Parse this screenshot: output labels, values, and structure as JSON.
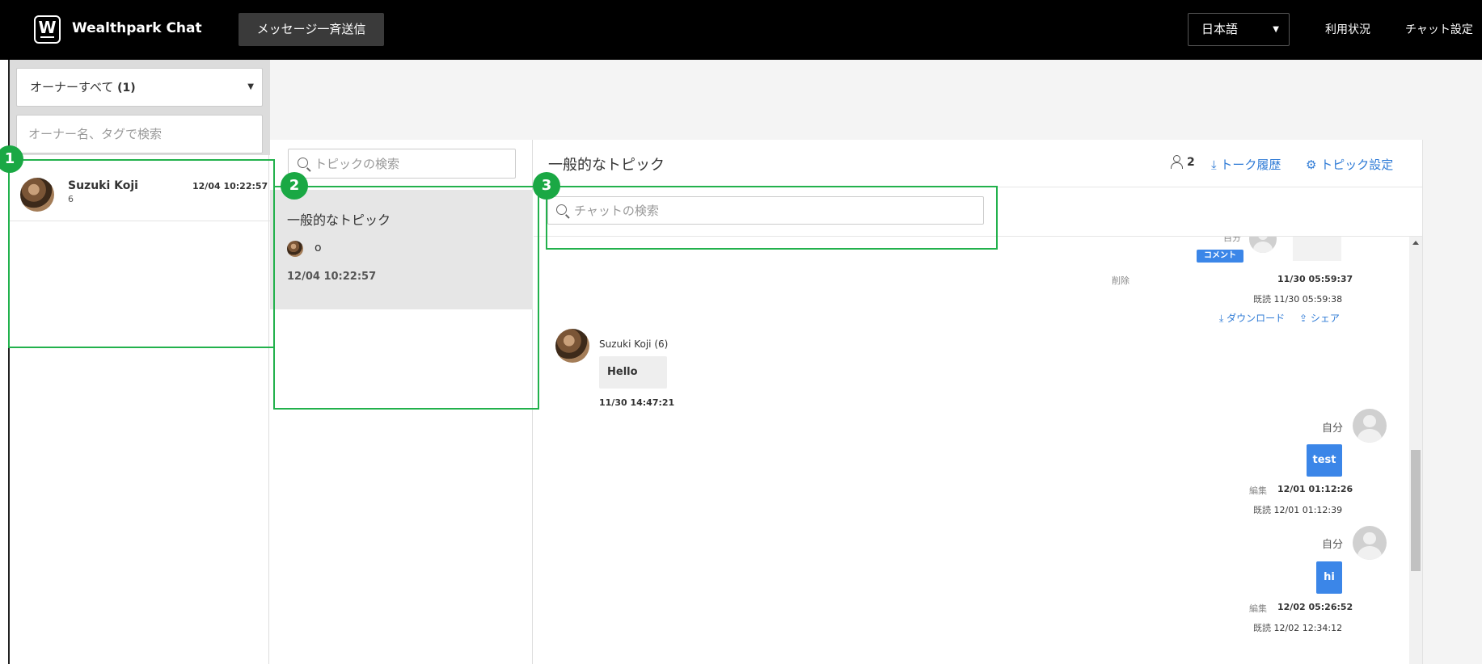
{
  "header": {
    "logo_letter": "W",
    "app_title": "Wealthpark Chat",
    "broadcast_label": "メッセージ一斉送信",
    "language": "日本語",
    "usage_link": "利用状況",
    "chat_settings_link": "チャット設定"
  },
  "owners": {
    "filter_label": "オーナーすべて",
    "filter_count": "(1)",
    "search_placeholder": "オーナー名、タグで検索",
    "items": [
      {
        "name": "Suzuki Koji",
        "count": "6",
        "time": "12/04 10:22:57"
      }
    ]
  },
  "topics": {
    "search_placeholder": "トピックの検索",
    "items": [
      {
        "title": "一般的なトピック",
        "last_message": "o",
        "time": "12/04 10:22:57"
      }
    ]
  },
  "chat": {
    "title": "一般的なトピック",
    "member_count": "2",
    "history_link": "トーク履歴",
    "topic_settings_link": "トピック設定",
    "search_placeholder": "チャットの検索",
    "messages": [
      {
        "sender": "自分",
        "comment_label": "コメント",
        "delete_label": "削除",
        "time": "11/30 05:59:37",
        "read_label": "既読",
        "read_time": "11/30 05:59:38",
        "download_label": "ダウンロード",
        "share_label": "シェア"
      },
      {
        "sender": "Suzuki Koji (6)",
        "text": "Hello",
        "time": "11/30 14:47:21"
      },
      {
        "sender": "自分",
        "text": "test",
        "edit_label": "編集",
        "time": "12/01 01:12:26",
        "read_label": "既読",
        "read_time": "12/01 01:12:39"
      },
      {
        "sender": "自分",
        "text": "hi",
        "edit_label": "編集",
        "time": "12/02 05:26:52",
        "read_label": "既読",
        "read_time": "12/02 12:34:12"
      }
    ]
  },
  "annotations": {
    "badges": [
      "1",
      "2",
      "3"
    ],
    "color": "#22b14c"
  },
  "colors": {
    "topbar": "#000000",
    "accent_blue": "#3b86e8",
    "link_blue": "#2f7bd6",
    "selected_topic_bg": "#e6e6e6"
  }
}
